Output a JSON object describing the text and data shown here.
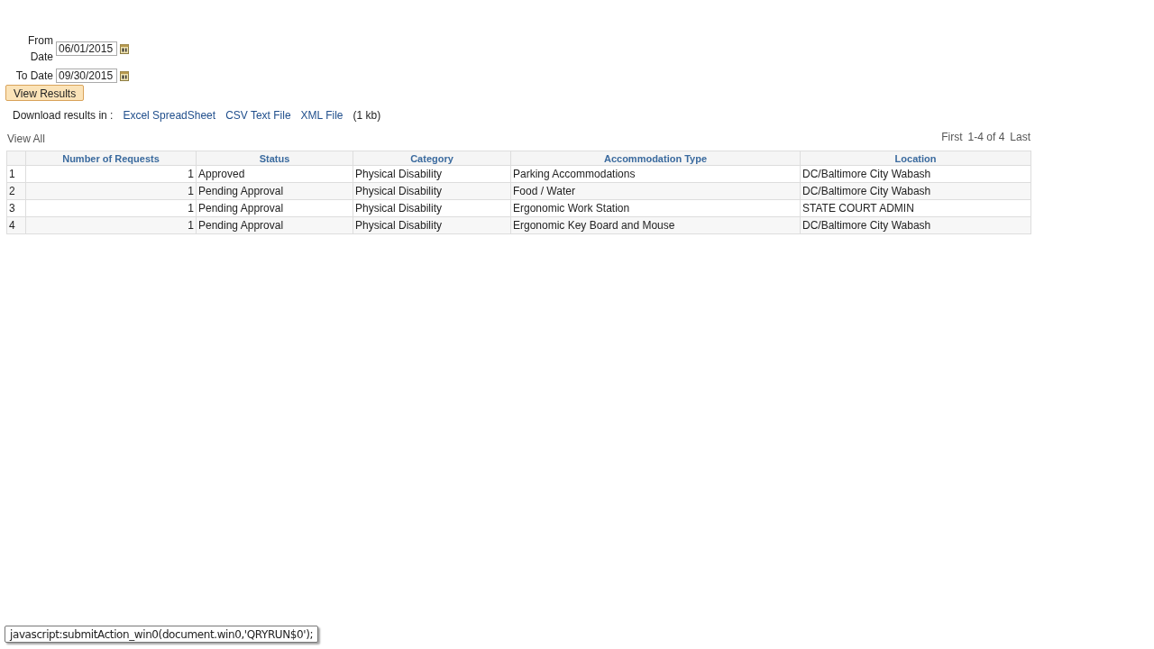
{
  "filters": [
    {
      "label": "From Date",
      "value": "06/01/2015"
    },
    {
      "label": "To Date",
      "value": "09/30/2015"
    }
  ],
  "view_button": "View Results",
  "download": {
    "label": "Download results in :",
    "links": [
      "Excel SpreadSheet",
      "CSV Text File",
      "XML File"
    ],
    "size": "(1 kb)"
  },
  "view_all": "View All",
  "pager": {
    "first": "First",
    "range": "1-4 of 4",
    "last": "Last"
  },
  "table": {
    "columns": [
      "Number of Requests",
      "Status",
      "Category",
      "Accommodation Type",
      "Location"
    ],
    "rows": [
      {
        "index": "1",
        "cells": [
          "1",
          "Approved",
          "Physical Disability",
          "Parking Accommodations",
          "DC/Baltimore City Wabash"
        ]
      },
      {
        "index": "2",
        "cells": [
          "1",
          "Pending Approval",
          "Physical Disability",
          "Food / Water",
          "DC/Baltimore City Wabash"
        ]
      },
      {
        "index": "3",
        "cells": [
          "1",
          "Pending Approval",
          "Physical Disability",
          "Ergonomic Work Station",
          "STATE COURT ADMIN"
        ]
      },
      {
        "index": "4",
        "cells": [
          "1",
          "Pending Approval",
          "Physical Disability",
          "Ergonomic Key Board and Mouse",
          "DC/Baltimore City Wabash"
        ]
      }
    ]
  },
  "status_bar": "javascript:submitAction_win0(document.win0,'QRYRUN$0');"
}
